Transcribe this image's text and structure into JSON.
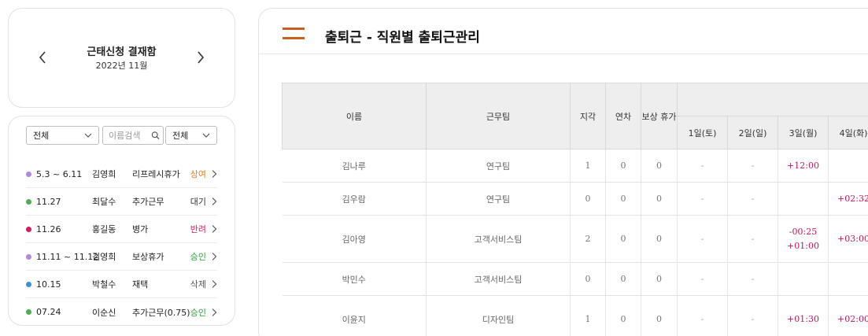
{
  "calendar": {
    "title": "근태신청 결재함",
    "period": "2022년 11월",
    "prev_icon": "chevron-left-icon",
    "next_icon": "chevron-right-icon"
  },
  "filters": {
    "category": "전체",
    "search_placeholder": "이름검색",
    "status": "전체"
  },
  "requests": [
    {
      "date": "5.3 ~ 6.11",
      "name": "김영희",
      "type": "리프레시휴가",
      "status": "상여",
      "dot_color": "#b784e0",
      "status_color": "#e67e22"
    },
    {
      "date": "11.27",
      "name": "최달수",
      "type": "추가근무",
      "status": "대기",
      "dot_color": "#4caf50",
      "status_color": "#333333"
    },
    {
      "date": "11.26",
      "name": "홍길동",
      "type": "병가",
      "status": "반려",
      "dot_color": "#d81b60",
      "status_color": "#d81b60"
    },
    {
      "date": "11.11 ~ 11.12",
      "name": "김영희",
      "type": "보상휴가",
      "status": "승인",
      "dot_color": "#b784e0",
      "status_color": "#2e9e3e"
    },
    {
      "date": "10.15",
      "name": "박철수",
      "type": "재택",
      "status": "삭제",
      "dot_color": "#3b8fd4",
      "status_color": "#555555"
    },
    {
      "date": "07.24",
      "name": "이순신",
      "type": "추가근무(0.75)",
      "status": "승인",
      "dot_color": "#4caf50",
      "status_color": "#2e9e3e"
    }
  ],
  "panel": {
    "title": "출퇴근 - 직원별 출퇴근관리",
    "menu_icon": "hamburger-icon"
  },
  "table": {
    "headers": {
      "name": "이름",
      "team": "근무팀",
      "late": "지각",
      "annual": "연차",
      "comp": "보상 휴가",
      "days": [
        "1일(토)",
        "2일(일)",
        "3일(월)",
        "4일(화)"
      ]
    },
    "rows": [
      {
        "name": "김나루",
        "team": "연구팀",
        "late": "1",
        "annual": "0",
        "comp": "0",
        "days": [
          "-",
          "-",
          "+12:00",
          ""
        ]
      },
      {
        "name": "김우람",
        "team": "연구팀",
        "late": "0",
        "annual": "0",
        "comp": "0",
        "days": [
          "-",
          "-",
          "",
          "+02:32"
        ]
      },
      {
        "name": "김아영",
        "team": "고객서비스팀",
        "late": "2",
        "annual": "0",
        "comp": "0",
        "days": [
          "-",
          "-",
          "-00:25\n+01:00",
          "+03:00"
        ]
      },
      {
        "name": "박민수",
        "team": "고객서비스팀",
        "late": "0",
        "annual": "0",
        "comp": "0",
        "days": [
          "-",
          "-",
          "",
          ""
        ]
      },
      {
        "name": "이윤지",
        "team": "디자인팀",
        "late": "1",
        "annual": "0",
        "comp": "0",
        "days": [
          "-",
          "-",
          "+01:30",
          "+02:00"
        ]
      }
    ]
  }
}
